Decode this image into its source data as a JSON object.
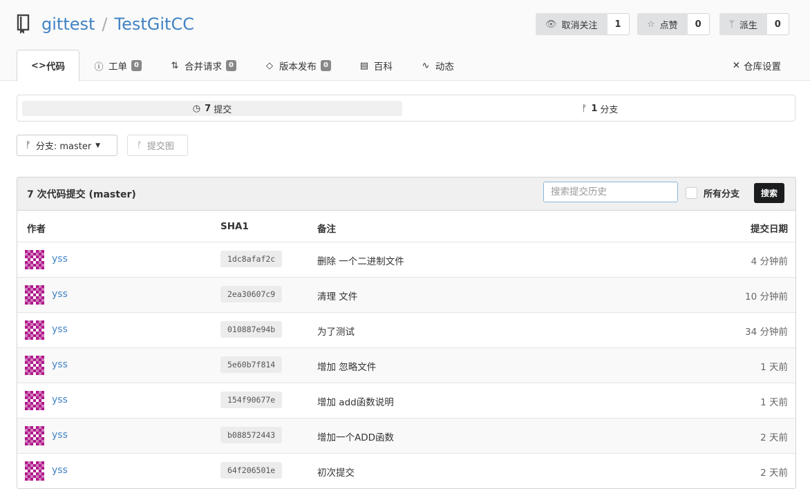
{
  "repo": {
    "owner": "gittest",
    "separator": "/",
    "name": "TestGitCC"
  },
  "actions": [
    {
      "icon": "eye-icon",
      "glyph": "👁",
      "label": "取消关注",
      "count": "1"
    },
    {
      "icon": "star-icon",
      "glyph": "☆",
      "label": "点赞",
      "count": "0"
    },
    {
      "icon": "fork-icon",
      "glyph": "ᛘ",
      "label": "派生",
      "count": "0"
    }
  ],
  "tabs": [
    {
      "icon": "code-icon",
      "glyph": "<>",
      "label": "代码",
      "active": true
    },
    {
      "icon": "issue-icon",
      "glyph": "ⓘ",
      "label": "工单",
      "badge": "0"
    },
    {
      "icon": "pull-request-icon",
      "glyph": "⇅",
      "label": "合并请求",
      "badge": "0"
    },
    {
      "icon": "tag-icon",
      "glyph": "◇",
      "label": "版本发布",
      "badge": "0"
    },
    {
      "icon": "wiki-icon",
      "glyph": "▤",
      "label": "百科"
    },
    {
      "icon": "activity-icon",
      "glyph": "∿",
      "label": "动态"
    }
  ],
  "settings_tab": {
    "icon": "tools-icon",
    "glyph": "✕",
    "label": "仓库设置"
  },
  "stats": {
    "commits_count": "7",
    "commits_label": "提交",
    "branches_count": "1",
    "branches_label": "分支"
  },
  "branch_selector": {
    "label": "分支: master"
  },
  "commit_graph": {
    "label": "提交图"
  },
  "commits": {
    "title": "7 次代码提交 (master)",
    "search_placeholder": "搜索提交历史",
    "all_branches_label": "所有分支",
    "search_button": "搜索",
    "columns": {
      "author": "作者",
      "sha": "SHA1",
      "message": "备注",
      "date": "提交日期"
    },
    "rows": [
      {
        "author": "yss",
        "sha": "1dc8afaf2c",
        "message": "删除 一个二进制文件",
        "date": "4 分钟前"
      },
      {
        "author": "yss",
        "sha": "2ea30607c9",
        "message": "清理 文件",
        "date": "10 分钟前"
      },
      {
        "author": "yss",
        "sha": "010887e94b",
        "message": "为了测试",
        "date": "34 分钟前"
      },
      {
        "author": "yss",
        "sha": "5e60b7f814",
        "message": "增加 忽略文件",
        "date": "1 天前"
      },
      {
        "author": "yss",
        "sha": "154f90677e",
        "message": "增加 add函数说明",
        "date": "1 天前"
      },
      {
        "author": "yss",
        "sha": "b088572443",
        "message": "增加一个ADD函数",
        "date": "2 天前"
      },
      {
        "author": "yss",
        "sha": "64f206501e",
        "message": "初次提交",
        "date": "2 天前"
      }
    ]
  },
  "colors": {
    "link": "#4183c4",
    "avatar": "#b0188a",
    "search_button": "#1b1c1d"
  }
}
